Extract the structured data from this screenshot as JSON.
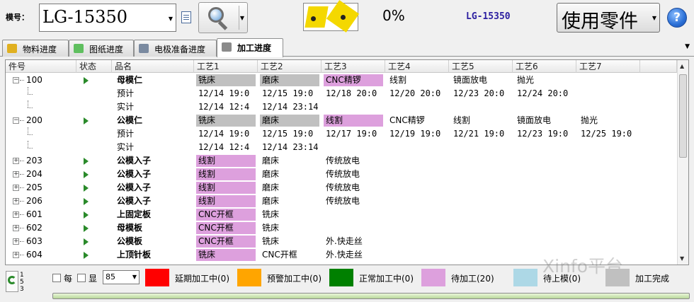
{
  "toolbar": {
    "mold_label": "模号：",
    "mold_value": "LG-15350",
    "progress_percent": "0%",
    "mold_code": "LG-15350",
    "use_parts_label": "使用零件",
    "help_label": "?"
  },
  "tabs": [
    {
      "label": "物料进度"
    },
    {
      "label": "图纸进度"
    },
    {
      "label": "电极准备进度"
    },
    {
      "label": "加工进度"
    }
  ],
  "active_tab": "加工进度",
  "grid": {
    "columns": [
      "件号",
      "状态",
      "品名",
      "工艺1",
      "工艺2",
      "工艺3",
      "工艺4",
      "工艺5",
      "工艺6",
      "工艺7"
    ],
    "rows": [
      {
        "kind": "part",
        "expander": "−",
        "id": "100",
        "name": "母模仁",
        "procs": [
          {
            "text": "铣床",
            "color": "#c0c0c0"
          },
          {
            "text": "磨床",
            "color": "#c0c0c0"
          },
          {
            "text": "CNC精锣",
            "color": "#dda0dd"
          },
          {
            "text": "线割",
            "color": ""
          },
          {
            "text": "镜面放电",
            "color": ""
          },
          {
            "text": "抛光",
            "color": ""
          }
        ]
      },
      {
        "kind": "sub",
        "name": "预计",
        "procs": [
          {
            "text": "12/14 19:0"
          },
          {
            "text": "12/15 19:0"
          },
          {
            "text": "12/18 20:0"
          },
          {
            "text": "12/20 20:0"
          },
          {
            "text": "12/23 20:0"
          },
          {
            "text": "12/24 20:0"
          }
        ]
      },
      {
        "kind": "sub",
        "name": "实计",
        "procs": [
          {
            "text": "12/14 12:4"
          },
          {
            "text": "12/14 23:14"
          }
        ]
      },
      {
        "kind": "part",
        "expander": "−",
        "id": "200",
        "name": "公模仁",
        "procs": [
          {
            "text": "铣床",
            "color": "#c0c0c0"
          },
          {
            "text": "磨床",
            "color": "#c0c0c0"
          },
          {
            "text": "线割",
            "color": "#dda0dd"
          },
          {
            "text": "CNC精锣",
            "color": ""
          },
          {
            "text": "线割",
            "color": ""
          },
          {
            "text": "镜面放电",
            "color": ""
          },
          {
            "text": "抛光",
            "color": ""
          }
        ]
      },
      {
        "kind": "sub",
        "name": "预计",
        "procs": [
          {
            "text": "12/14 19:0"
          },
          {
            "text": "12/15 19:0"
          },
          {
            "text": "12/17 19:0"
          },
          {
            "text": "12/19 19:0"
          },
          {
            "text": "12/21 19:0"
          },
          {
            "text": "12/23 19:0"
          },
          {
            "text": "12/25 19:0"
          }
        ]
      },
      {
        "kind": "sub",
        "name": "实计",
        "procs": [
          {
            "text": "12/14 12:4"
          },
          {
            "text": "12/14 23:14"
          }
        ]
      },
      {
        "kind": "part",
        "expander": "+",
        "id": "203",
        "name": "公模入子",
        "procs": [
          {
            "text": "线割",
            "color": "#dda0dd"
          },
          {
            "text": "磨床",
            "color": ""
          },
          {
            "text": "传统放电",
            "color": ""
          }
        ]
      },
      {
        "kind": "part",
        "expander": "+",
        "id": "204",
        "name": "公模入子",
        "procs": [
          {
            "text": "线割",
            "color": "#dda0dd"
          },
          {
            "text": "磨床",
            "color": ""
          },
          {
            "text": "传统放电",
            "color": ""
          }
        ]
      },
      {
        "kind": "part",
        "expander": "+",
        "id": "205",
        "name": "公模入子",
        "procs": [
          {
            "text": "线割",
            "color": "#dda0dd"
          },
          {
            "text": "磨床",
            "color": ""
          },
          {
            "text": "传统放电",
            "color": ""
          }
        ]
      },
      {
        "kind": "part",
        "expander": "+",
        "id": "206",
        "name": "公模入子",
        "procs": [
          {
            "text": "线割",
            "color": "#dda0dd"
          },
          {
            "text": "磨床",
            "color": ""
          },
          {
            "text": "传统放电",
            "color": ""
          }
        ]
      },
      {
        "kind": "part",
        "expander": "+",
        "id": "601",
        "name": "上固定板",
        "procs": [
          {
            "text": "CNC开框",
            "color": "#dda0dd"
          },
          {
            "text": "铣床",
            "color": ""
          }
        ]
      },
      {
        "kind": "part",
        "expander": "+",
        "id": "602",
        "name": "母模板",
        "procs": [
          {
            "text": "CNC开框",
            "color": "#dda0dd"
          },
          {
            "text": "铣床",
            "color": ""
          }
        ]
      },
      {
        "kind": "part",
        "expander": "+",
        "id": "603",
        "name": "公模板",
        "procs": [
          {
            "text": "CNC开框",
            "color": "#dda0dd"
          },
          {
            "text": "铣床",
            "color": ""
          },
          {
            "text": "外.快走丝",
            "color": ""
          }
        ]
      },
      {
        "kind": "part",
        "expander": "+",
        "id": "604",
        "name": "上顶针板",
        "procs": [
          {
            "text": "铣床",
            "color": "#dda0dd"
          },
          {
            "text": "CNC开框",
            "color": ""
          },
          {
            "text": "外.快走丝",
            "color": ""
          }
        ]
      }
    ]
  },
  "footer": {
    "pager_lines": [
      "1",
      "5",
      "3"
    ],
    "cb_each_label": "每",
    "cb_show_label": "显",
    "page_size": "85",
    "legend": [
      {
        "label": "延期加工中(0)",
        "color": "#ff0000"
      },
      {
        "label": "预警加工中(0)",
        "color": "#ffa500"
      },
      {
        "label": "正常加工中(0)",
        "color": "#008000"
      },
      {
        "label": "待加工(20)",
        "color": "#dda0dd"
      },
      {
        "label": "待上模(0)",
        "color": "#add8e6"
      },
      {
        "label": "加工完成",
        "color": "#c0c0c0"
      }
    ]
  },
  "watermark": "Xinfo平台"
}
